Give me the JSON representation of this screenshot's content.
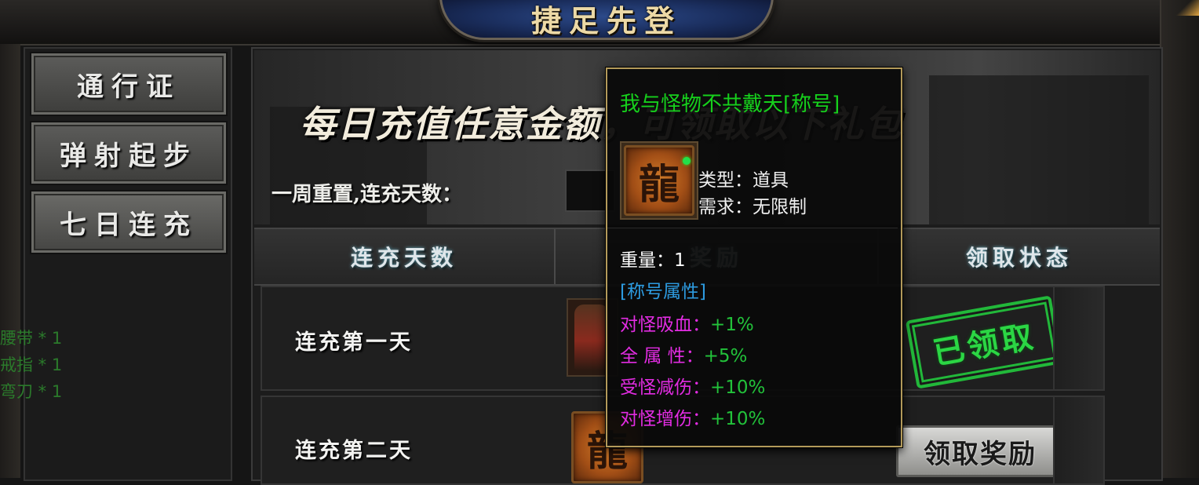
{
  "header": {
    "title": "捷足先登"
  },
  "sidebar": {
    "items": [
      {
        "label": "通行证"
      },
      {
        "label": "弹射起步"
      },
      {
        "label": "七日连充",
        "active": true
      }
    ]
  },
  "left_list": [
    "腰带 * 1",
    "戒指 * 1",
    "弯刀 * 1"
  ],
  "banner": {
    "title": "每日充值任意金额，可领取以下礼包",
    "reset_label": "一周重置,连充天数："
  },
  "table": {
    "headers": [
      "连充天数",
      "奖励",
      "领取状态"
    ],
    "rows": [
      {
        "day_label": "连充第一天",
        "status": "已领取",
        "status_type": "stamp"
      },
      {
        "day_label": "连充第二天",
        "status": "领取奖励",
        "status_type": "button"
      }
    ]
  },
  "tooltip": {
    "item_name": "我与怪物不共戴天[称号]",
    "icon": "dragon-emblem-icon",
    "type_label": "类型：",
    "type_value": "道具",
    "require_label": "需求：",
    "require_value": "无限制",
    "weight_label": "重量：",
    "weight_value": "1",
    "attr_header": "[称号属性]",
    "attributes": [
      {
        "name": "对怪吸血：",
        "value": "+1%"
      },
      {
        "name": "全 属 性：",
        "value": "+5%"
      },
      {
        "name": "受怪减伤：",
        "value": "+10%"
      },
      {
        "name": "对怪增伤：",
        "value": "+10%"
      }
    ]
  },
  "colors": {
    "item_name": "#16d01c",
    "attr_header": "#2d9be0",
    "attr_key": "#e22ce2",
    "attr_value": "#22c23a",
    "stamp": "#22b83a"
  }
}
